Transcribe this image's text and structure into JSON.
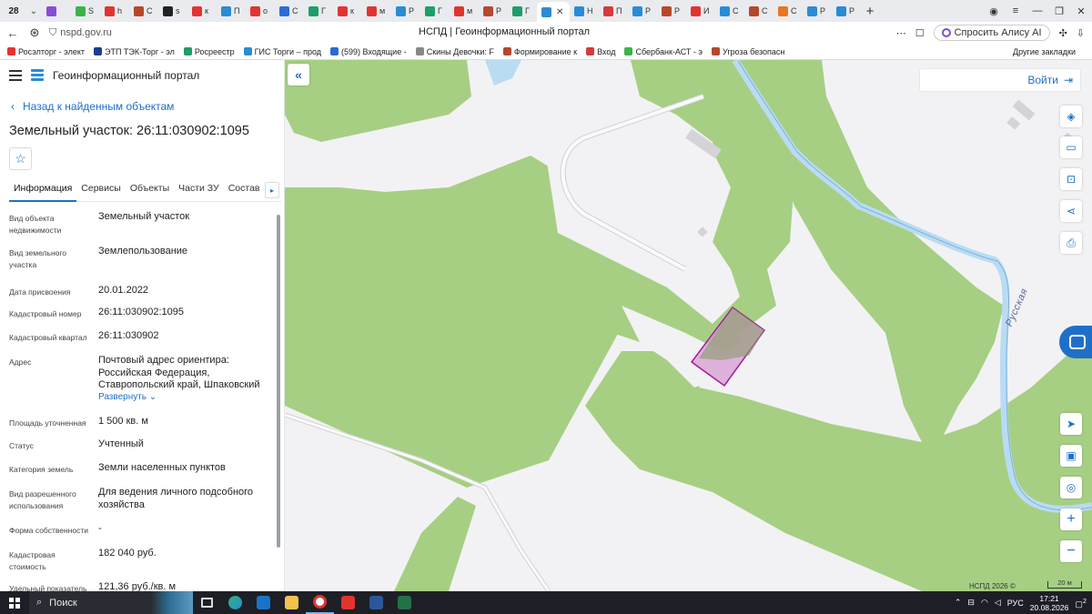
{
  "browser": {
    "tab_count": "28",
    "tabs": [
      {
        "label": "",
        "color": "#8a4dd6"
      },
      {
        "label": "S",
        "color": "#3bb34a"
      },
      {
        "label": "h",
        "color": "#e2342f"
      },
      {
        "label": "С",
        "color": "#b5482c"
      },
      {
        "label": "s",
        "color": "#222222"
      },
      {
        "label": "к",
        "color": "#e2342f"
      },
      {
        "label": "П",
        "color": "#2a8bd6"
      },
      {
        "label": "о",
        "color": "#e2342f"
      },
      {
        "label": "С",
        "color": "#2a6bd6"
      },
      {
        "label": "Г",
        "color": "#1e9e6a"
      },
      {
        "label": "к",
        "color": "#e2342f"
      },
      {
        "label": "м",
        "color": "#e2342f"
      },
      {
        "label": "Р",
        "color": "#2a8bd6"
      },
      {
        "label": "Г",
        "color": "#1e9e6a"
      },
      {
        "label": "м",
        "color": "#e2342f"
      },
      {
        "label": "Р",
        "color": "#b5482c"
      },
      {
        "label": "Г",
        "color": "#1e9e6a"
      }
    ],
    "active_tab": {
      "label": "",
      "color": "#2a8bd6"
    },
    "tabs_after": [
      {
        "label": "Н",
        "color": "#2a8bd6"
      },
      {
        "label": "П",
        "color": "#d63a3a"
      },
      {
        "label": "Р",
        "color": "#2a8bd6"
      },
      {
        "label": "Р",
        "color": "#b5482c"
      },
      {
        "label": "И",
        "color": "#e2342f"
      },
      {
        "label": "С",
        "color": "#2a8bd6"
      },
      {
        "label": "С",
        "color": "#b5482c"
      },
      {
        "label": "С",
        "color": "#e87722"
      },
      {
        "label": "Р",
        "color": "#2a8bd6"
      },
      {
        "label": "Р",
        "color": "#2a8bd6"
      }
    ],
    "url": "nspd.gov.ru",
    "page_title": "НСПД | Геоинформационный портал",
    "alice_label": "Спросить Алису AI",
    "bookmarks": [
      {
        "label": "Росэлторг - элект",
        "color": "#e2342f"
      },
      {
        "label": "ЭТП ТЭК-Торг - эл",
        "color": "#1a3d8f"
      },
      {
        "label": "Росреестр",
        "color": "#1e9e6a"
      },
      {
        "label": "ГИС Торги – прод",
        "color": "#2a8bd6"
      },
      {
        "label": "(599) Входящие -",
        "color": "#2a6bd6"
      },
      {
        "label": "Скины Девочки: F",
        "color": "#888888"
      },
      {
        "label": "Формирование к",
        "color": "#b5482c"
      },
      {
        "label": "Вход",
        "color": "#d63a3a"
      },
      {
        "label": "Сбербанк-АСТ - э",
        "color": "#3bb34a"
      },
      {
        "label": "Угроза безопасн",
        "color": "#b5482c"
      }
    ],
    "other_bookmarks": "Другие закладки"
  },
  "sidebar": {
    "portal_name": "Геоинформационный портал",
    "back_label": "Назад к найденным объектам",
    "object_title": "Земельный участок: 26:11:030902:1095",
    "tabs": [
      "Информация",
      "Сервисы",
      "Объекты",
      "Части ЗУ",
      "Состав"
    ],
    "properties": [
      {
        "label": "Вид объекта недвижимости",
        "value": "Земельный участок"
      },
      {
        "label": "Вид земельного участка",
        "value": "Землепользование"
      },
      {
        "label": "Дата присвоения",
        "value": "20.01.2022"
      },
      {
        "label": "Кадастровый номер",
        "value": "26:11:030902:1095"
      },
      {
        "label": "Кадастровый квартал",
        "value": "26:11:030902"
      },
      {
        "label": "Адрес",
        "value": "Почтовый адрес ориентира: Российская Федерация, Ставропольский край, Шпаковский"
      },
      {
        "label": "Площадь уточненная",
        "value": "1 500 кв. м"
      },
      {
        "label": "Статус",
        "value": "Учтенный"
      },
      {
        "label": "Категория земель",
        "value": "Земли населенных пунктов"
      },
      {
        "label": "Вид разрешенного использования",
        "value": "Для ведения личного подсобного хозяйства"
      },
      {
        "label": "Форма собственности",
        "value": "-"
      },
      {
        "label": "Кадастровая стоимость",
        "value": "182 040 руб."
      },
      {
        "label": "Удельный показатель",
        "value": "121,36 руб./кв. м"
      }
    ],
    "expand_label": "Развернуть"
  },
  "map": {
    "login_label": "Войти",
    "road_label": "Русская",
    "copyright": "НСПД 2026 ©",
    "scale": "20 м",
    "colors": {
      "forest": "#a6cf83",
      "water": "#b9dcf3",
      "parcel_stroke": "#a6199b",
      "parcel_fill": "#d9a7d6"
    }
  },
  "taskbar": {
    "search_label": "Поиск",
    "lang": "РУС",
    "time": "17:21",
    "date": "20.08.2026",
    "notif_count": "2"
  }
}
